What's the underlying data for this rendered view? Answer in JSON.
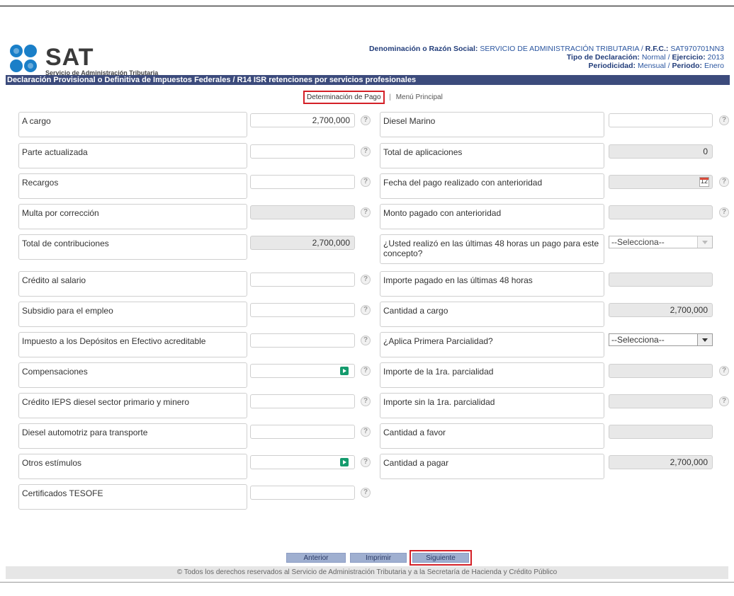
{
  "header": {
    "logo_text": "SAT",
    "logo_subtitle": "Servicio de Administración Tributaria",
    "line1_label": "Denominación o Razón Social:",
    "line1_value": "SERVICIO DE ADMINISTRACIÓN TRIBUTARIA",
    "line1_sep": "/",
    "rfc_label": "R.F.C.:",
    "rfc_value": "SAT970701NN3",
    "tipo_label": "Tipo de Declaración:",
    "tipo_value": "Normal",
    "ejercicio_label": "Ejercicio:",
    "ejercicio_value": "2013",
    "periodicidad_label": "Periodicidad:",
    "periodicidad_value": "Mensual",
    "periodo_label": "Periodo:",
    "periodo_value": "Enero",
    "slash": "/"
  },
  "title_bar": "Declaración Provisional o Definitiva de Impuestos Federales / R14 ISR retenciones por servicios profesionales",
  "nav": {
    "active": "Determinación de Pago",
    "separator": "|",
    "other": "Menú Principal"
  },
  "help_glyph": "?",
  "left_fields": [
    {
      "label": "A cargo",
      "value": "2,700,000"
    },
    {
      "label": "Parte actualizada",
      "value": ""
    },
    {
      "label": "Recargos",
      "value": ""
    },
    {
      "label": "Multa por corrección",
      "value": ""
    },
    {
      "label": "Total de contribuciones",
      "value": "2,700,000"
    },
    {
      "label": "Crédito al salario",
      "value": ""
    },
    {
      "label": "Subsidio para el empleo",
      "value": ""
    },
    {
      "label": "Impuesto a los Depósitos en Efectivo acreditable",
      "value": ""
    },
    {
      "label": "Compensaciones",
      "value": ""
    },
    {
      "label": "Crédito IEPS diesel sector primario y minero",
      "value": ""
    },
    {
      "label": "Diesel automotriz para transporte",
      "value": ""
    },
    {
      "label": "Otros estímulos",
      "value": ""
    },
    {
      "label": "Certificados TESOFE",
      "value": ""
    }
  ],
  "right_fields": [
    {
      "label": "Diesel Marino",
      "value": ""
    },
    {
      "label": "Total de aplicaciones",
      "value": "0"
    },
    {
      "label": "Fecha del pago realizado con anterioridad",
      "value": "",
      "calendar_day": "12"
    },
    {
      "label": "Monto pagado con anterioridad",
      "value": ""
    },
    {
      "label": "¿Usted realizó en las últimas 48 horas un pago para este concepto?",
      "select": "--Selecciona--"
    },
    {
      "label": "Importe pagado en las últimas 48 horas",
      "value": ""
    },
    {
      "label": "Cantidad a cargo",
      "value": "2,700,000"
    },
    {
      "label": "¿Aplica Primera Parcialidad?",
      "select": "--Selecciona--"
    },
    {
      "label": "Importe de la 1ra. parcialidad",
      "value": ""
    },
    {
      "label": "Importe sin la 1ra. parcialidad",
      "value": ""
    },
    {
      "label": "Cantidad a favor",
      "value": ""
    },
    {
      "label": "Cantidad a pagar",
      "value": "2,700,000"
    }
  ],
  "buttons": {
    "anterior": "Anterior",
    "imprimir": "Imprimir",
    "siguiente": "Siguiente"
  },
  "footer": "© Todos los derechos reservados al Servicio de Administración Tributaria y a la Secretaría de Hacienda y Crédito Público",
  "colors": {
    "title_bar": "#3c4b7c",
    "header_text": "#2b56a0",
    "highlight": "#d42027",
    "button": "#9fafd0"
  }
}
